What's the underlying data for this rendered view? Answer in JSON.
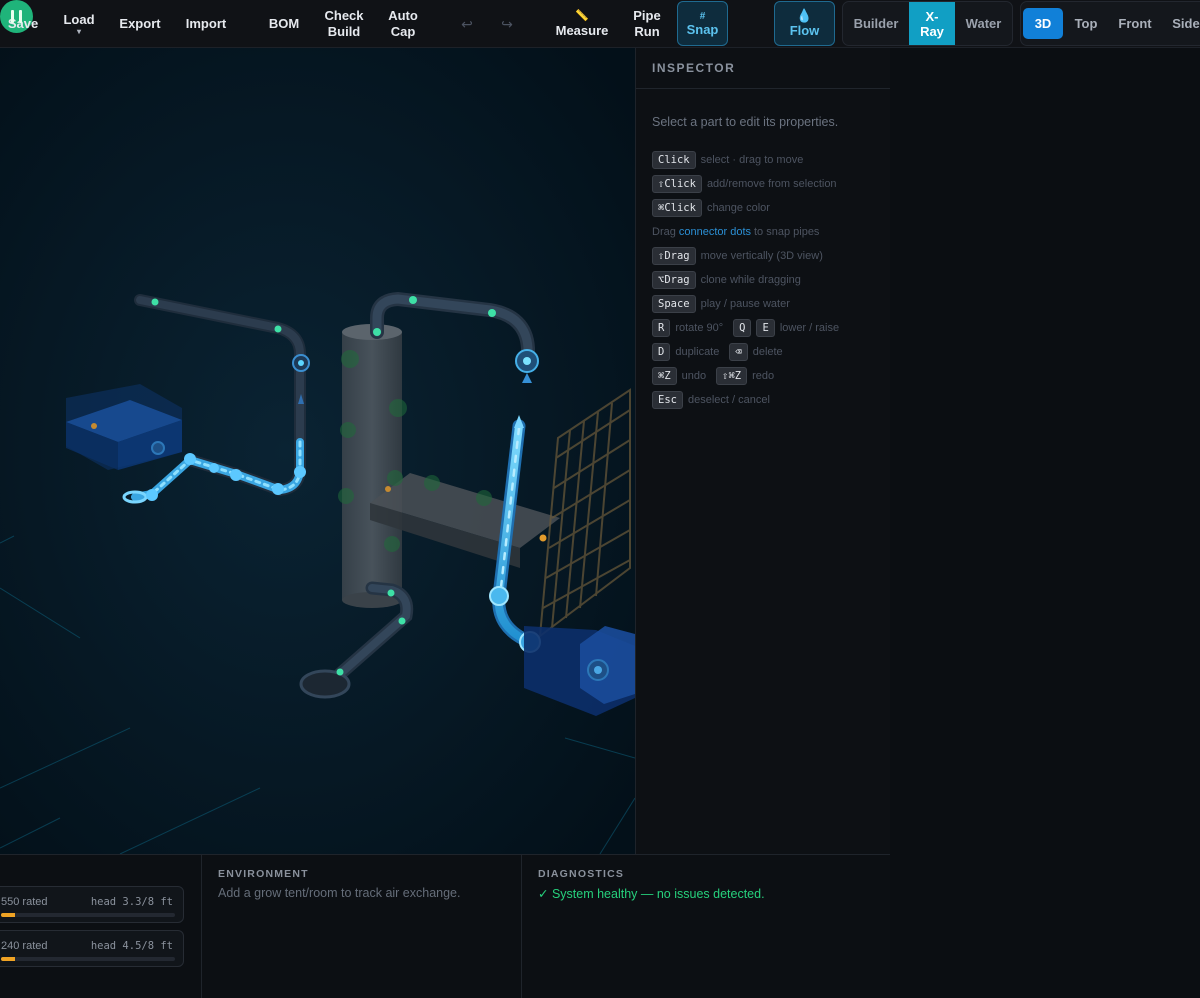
{
  "toolbar": {
    "save": "Save",
    "load": "Load",
    "load_caret": "▾",
    "export": "Export",
    "import": "Import",
    "bom": "BOM",
    "check_build_1": "Check",
    "check_build_2": "Build",
    "auto_cap_1": "Auto",
    "auto_cap_2": "Cap",
    "undo_icon": "↩",
    "redo_icon": "↪",
    "measure_icon": "📏",
    "measure": "Measure",
    "pipe_run_1": "Pipe",
    "pipe_run_2": "Run",
    "snap_symbol": "#",
    "snap": "Snap",
    "flow_symbol": "💧",
    "flow": "Flow",
    "modes": {
      "builder": "Builder",
      "xray_1": "X-",
      "xray_2": "Ray",
      "water": "Water"
    },
    "views": {
      "v3d": "3D",
      "top": "Top",
      "front": "Front",
      "side": "Side"
    },
    "active_mode": "X-Ray",
    "active_view": "3D"
  },
  "inspector": {
    "title": "INSPECTOR",
    "hint": "Select a part to edit its properties.",
    "shortcuts": {
      "click_key": "Click",
      "click_desc": "select · drag to move",
      "shiftclick_key": "⇧Click",
      "shiftclick_desc": "add/remove from selection",
      "cmdclick_key": "⌘Click",
      "cmdclick_desc": "change color",
      "drag_pre": "Drag",
      "drag_link": "connector dots",
      "drag_post": "to snap pipes",
      "shiftdrag_key": "⇧Drag",
      "shiftdrag_desc": "move vertically (3D view)",
      "altdrag_key": "⌥Drag",
      "altdrag_desc": "clone while dragging",
      "space_key": "Space",
      "space_desc": "play / pause water",
      "r_key": "R",
      "r_desc": "rotate 90°",
      "q_key": "Q",
      "e_key": "E",
      "qe_desc": "lower / raise",
      "d_key": "D",
      "d_desc": "duplicate",
      "del_key": "⌫",
      "del_desc": "delete",
      "undo_key": "⌘Z",
      "undo_desc": "undo",
      "redo_key": "⇧⌘Z",
      "redo_desc": "redo",
      "esc_key": "Esc",
      "esc_desc": "deselect / cancel"
    }
  },
  "bottom": {
    "pumps": [
      {
        "rated": "550 rated",
        "head": "head 3.3/8 ft",
        "level": 0.08
      },
      {
        "rated": "240 rated",
        "head": "head 4.5/8 ft",
        "level": 0.08
      }
    ],
    "environment_title": "ENVIRONMENT",
    "environment_text": "Add a grow tent/room to track air exchange.",
    "diagnostics_title": "DIAGNOSTICS",
    "diagnostics_text": "✓ System healthy — no issues detected."
  },
  "colors": {
    "accent": "#119fc4",
    "active_view": "#1180d8",
    "healthy": "#26d07c",
    "pipe_glow": "#39b4ec",
    "connector": "#3ee0a6",
    "warning": "#f0a324"
  }
}
